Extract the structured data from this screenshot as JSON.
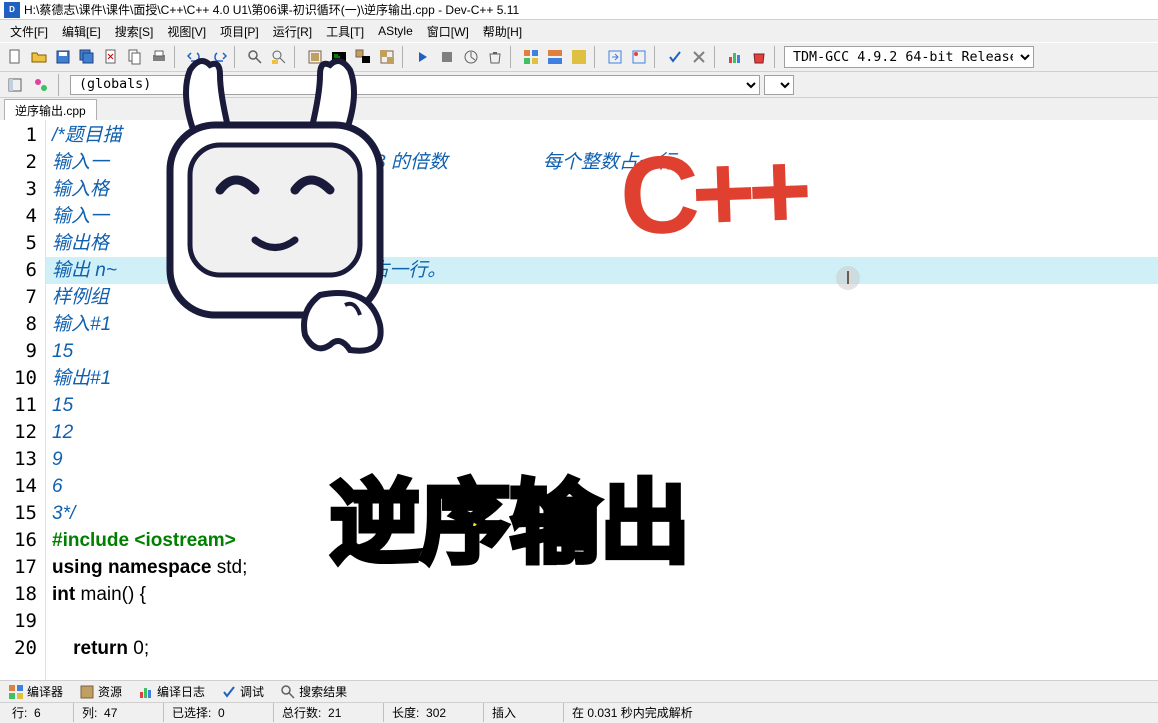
{
  "title": "H:\\蔡德志\\课件\\课件\\面授\\C++\\C++ 4.0 U1\\第06课-初识循环(一)\\逆序输出.cpp - Dev-C++ 5.11",
  "menu": {
    "file": "文件[F]",
    "edit": "编辑[E]",
    "search": "搜索[S]",
    "view": "视图[V]",
    "project": "项目[P]",
    "run": "运行[R]",
    "tools": "工具[T]",
    "astyle": "AStyle",
    "window": "窗口[W]",
    "help": "帮助[H]"
  },
  "compiler_select": "TDM-GCC 4.9.2 64-bit Release",
  "globals_select": "(globals)",
  "tab_label": "逆序输出.cpp",
  "code_lines": [
    {
      "n": 1,
      "cls": "comment",
      "text": "/*题目描"
    },
    {
      "n": 2,
      "cls": "comment",
      "text": "输入一                                   间满足是 3 的倍数                  每个整数占一行。"
    },
    {
      "n": 3,
      "cls": "comment",
      "text": "输入格"
    },
    {
      "n": 4,
      "cls": "comment",
      "text": "输入一"
    },
    {
      "n": 5,
      "cls": "comment",
      "text": "输出格"
    },
    {
      "n": 6,
      "cls": "comment hl",
      "text": "输出 n~                              ，每个整数占一行。"
    },
    {
      "n": 7,
      "cls": "comment",
      "text": "样例组"
    },
    {
      "n": 8,
      "cls": "comment",
      "text": "输入#1"
    },
    {
      "n": 9,
      "cls": "comment",
      "text": "15"
    },
    {
      "n": 10,
      "cls": "comment",
      "text": "输出#1"
    },
    {
      "n": 11,
      "cls": "comment",
      "text": "15"
    },
    {
      "n": 12,
      "cls": "comment",
      "text": "12"
    },
    {
      "n": 13,
      "cls": "comment",
      "text": "9"
    },
    {
      "n": 14,
      "cls": "comment",
      "text": "6"
    },
    {
      "n": 15,
      "cls": "comment",
      "text": "3*/"
    },
    {
      "n": 16,
      "cls": "preproc",
      "text": "#include <iostream>"
    },
    {
      "n": 17,
      "cls": "",
      "text": "",
      "html": "<span class='keyword'>using namespace</span> std;"
    },
    {
      "n": 18,
      "cls": "",
      "text": "",
      "html": "<span class='keyword'>int</span> main() {"
    },
    {
      "n": 19,
      "cls": "",
      "text": ""
    },
    {
      "n": 20,
      "cls": "",
      "text": "",
      "html": "    <span class='keyword'>return</span> 0;"
    }
  ],
  "bottom_tabs": {
    "compiler": "编译器",
    "resources": "资源",
    "compile_log": "编译日志",
    "debug": "调试",
    "search_results": "搜索结果"
  },
  "status": {
    "row_label": "行:",
    "row": "6",
    "col_label": "列:",
    "col": "47",
    "sel_label": "已选择:",
    "sel": "0",
    "total_label": "总行数:",
    "total": "21",
    "len_label": "长度:",
    "len": "302",
    "mode": "插入",
    "parse": "在 0.031 秒内完成解析"
  },
  "overlay_cpp": "C++",
  "overlay_title": "逆序输出",
  "overlay_cursor": "I"
}
